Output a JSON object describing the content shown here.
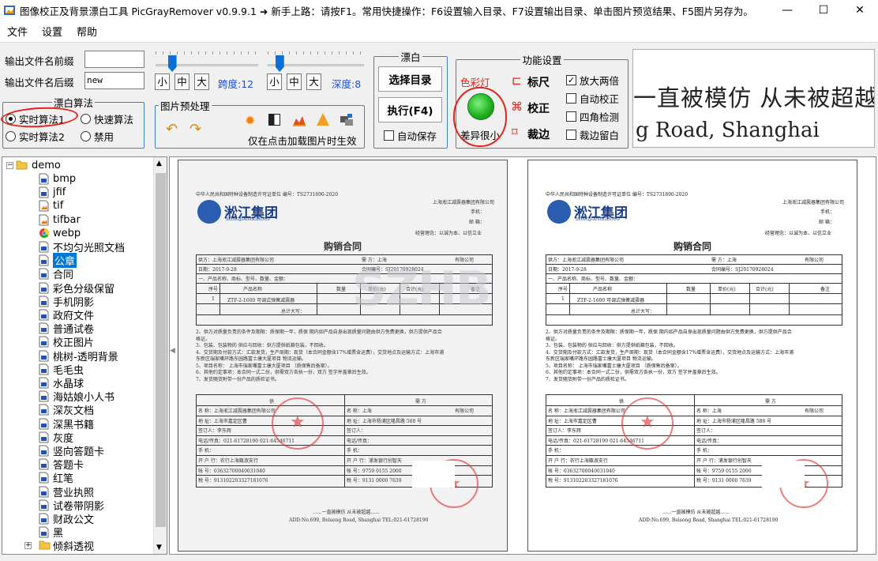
{
  "window": {
    "title": "图像校正及背景漂白工具 PicGrayRemover v0.9.9.1 ➜ 新手上路：请按F1。常用快捷操作：F6设置输入目录、F7设置输出目录、单击图片预览结果、F5图片另存为。",
    "minimize": "—",
    "maximize": "☐",
    "close": "✕"
  },
  "menu": [
    "文件",
    "设置",
    "帮助"
  ],
  "output": {
    "prefix_label": "输出文件名前缀",
    "prefix_value": "",
    "suffix_label": "输出文件名后缀",
    "suffix_value": "new"
  },
  "algorithm": {
    "legend": "漂白算法",
    "options": [
      "实时算法1",
      "快速算法",
      "实时算法2",
      "禁用"
    ],
    "selected": "实时算法1"
  },
  "sliders": {
    "span": {
      "small": "小",
      "medium": "中",
      "large": "大",
      "label": "跨度:",
      "value": "12",
      "level": 0.12
    },
    "depth": {
      "small": "小",
      "medium": "中",
      "large": "大",
      "label": "深度:",
      "value": "8",
      "level": 0.08
    }
  },
  "preprocess": {
    "legend": "图片预处理",
    "note": "仅在点击加载图片时生效",
    "icons": [
      "undo-icon",
      "redo-icon",
      "brightness-icon",
      "contrast-icon",
      "levels-icon",
      "warning-icon",
      "convert-icon"
    ]
  },
  "bleach": {
    "legend": "漂白",
    "select_dir": "选择目录",
    "execute": "执行(F4)",
    "autosave": "自动保存",
    "autosave_checked": false
  },
  "features": {
    "legend": "功能设置",
    "color_light": "色彩灯",
    "diff_label": "差异很小",
    "ruler": "标尺",
    "correct": "校正",
    "crop": "裁边",
    "zoom2x": "放大两倍",
    "zoom2x_checked": true,
    "auto_correct": "自动校正",
    "auto_correct_checked": false,
    "corner_detect": "四角检测",
    "corner_detect_checked": false,
    "crop_margin": "裁边留白",
    "crop_margin_checked": false,
    "light_color": "#22b422"
  },
  "preview_zoom": {
    "line1": "一直被模仿  从未被超越",
    "line2": "g Road, Shanghai"
  },
  "tree": {
    "root": "demo",
    "items": [
      {
        "name": "bmp",
        "type": "file"
      },
      {
        "name": "jfif",
        "type": "file"
      },
      {
        "name": "tif",
        "type": "image"
      },
      {
        "name": "tifbar",
        "type": "image"
      },
      {
        "name": "webp",
        "type": "chrome"
      },
      {
        "name": "不均匀光照文档",
        "type": "file"
      },
      {
        "name": "公章",
        "type": "file",
        "selected": true
      },
      {
        "name": "合同",
        "type": "file"
      },
      {
        "name": "彩色分级保留",
        "type": "file"
      },
      {
        "name": "手机阴影",
        "type": "file"
      },
      {
        "name": "政府文件",
        "type": "file"
      },
      {
        "name": "普通试卷",
        "type": "file"
      },
      {
        "name": "校正图片",
        "type": "file"
      },
      {
        "name": "桃树-透明背景",
        "type": "file"
      },
      {
        "name": "毛毛虫",
        "type": "file"
      },
      {
        "name": "水晶球",
        "type": "file"
      },
      {
        "name": "海姑娘小人书",
        "type": "file"
      },
      {
        "name": "深灰文档",
        "type": "file"
      },
      {
        "name": "深黑书籍",
        "type": "file"
      },
      {
        "name": "灰度",
        "type": "file"
      },
      {
        "name": "竖向答题卡",
        "type": "file"
      },
      {
        "name": "答题卡",
        "type": "file"
      },
      {
        "name": "红笔",
        "type": "file"
      },
      {
        "name": "营业执照",
        "type": "file"
      },
      {
        "name": "试卷带阴影",
        "type": "file"
      },
      {
        "name": "财政公文",
        "type": "file"
      },
      {
        "name": "黑",
        "type": "file"
      },
      {
        "name": "倾斜透视",
        "type": "folder"
      }
    ]
  },
  "document": {
    "header_left": "中华人民共和国特种设备制造许可证单位  编号：TS2731890-2020",
    "company_right": "上海淞江减震器集团有限公司",
    "phone_label": "手机：",
    "email_label": "邮  箱：",
    "motto": "经营理念：以诚为本、以信立业",
    "logo_cn": "淞江集团",
    "logo_en": "SONGJIANGGROUP",
    "title": "购销合同",
    "supplier": "供方：上海淞江减震器集团有限公司",
    "buyer": "需      方：上海",
    "buyer_suffix": "有限公司",
    "date": "日期：2017-9-28",
    "contract_no": "合同编号：SJ20170928024",
    "section1": "一、产品名称、商标、型号、数量、金额：",
    "th": [
      "序号",
      "产品名称",
      "数量",
      "单价(元)",
      "合计(元)",
      "备注"
    ],
    "row1": [
      "1",
      "ZTF-2-1600 可调式弹簧减震器"
    ],
    "total": "总计大写：",
    "clauses": [
      "2、供方对质量负责的条件及期限：质保期一年，质保  期内如产品自身出现质量问题由供方免费更换，供方提供产品合",
      "格证。",
      "3、包装、包装物的  供应与回收：供方提供纸箱包装，不回收。",
      "4、交货期及付款方式：汇款发货，生产周期：现货（本合同金额含17%增票含运费），交货地点及运输方式：上海市浦",
      "东新区瑞家嘴环路东园路富士康大厦项目                    物流运输。",
      "5、项目名称：    上海市瑞家嘴富士康大厦项目              （质保售后备案）。",
      "6、其他约定事项：本合同一式二份，供需双方各执一份，双方  签字并盖章后生效。",
      "7、发货随货附带一份产品的质检证书。"
    ],
    "party_supplier": "供",
    "party_buyer": "需          方",
    "sign_rows_left": [
      "名  称：上海淞江减震器集团有限公司",
      "地  址：上海市嘉定区曹",
      "签订人：李东辉",
      "电话/传真：021-61728190   021-64546711",
      "手    机：",
      "开 户 行：农行上海甑淑支行",
      "帐    号：03632700040031040",
      "税    号：913102203327181076"
    ],
    "sign_rows_right": [
      "名    称：上海",
      "地  址：上海市杨浦区隆昌路 588 号",
      "签订人：",
      "电话/传真：",
      "手    机：",
      "开 户 行：浦发银行创智天",
      "帐    号：9759 0155 2000",
      "税    号：9131 0000 7639"
    ],
    "bottom_left": "有限公司",
    "footer1": "......一直被模仿  从未被超越......",
    "footer2": "ADD:No.699, Beisong Road, Shanghai    TEL:021-61728190"
  },
  "colors": {
    "accent": "#1e50d4",
    "groupbox": "#3c7fd8",
    "selection": "#0078d7",
    "annotation": "#e0241c"
  }
}
